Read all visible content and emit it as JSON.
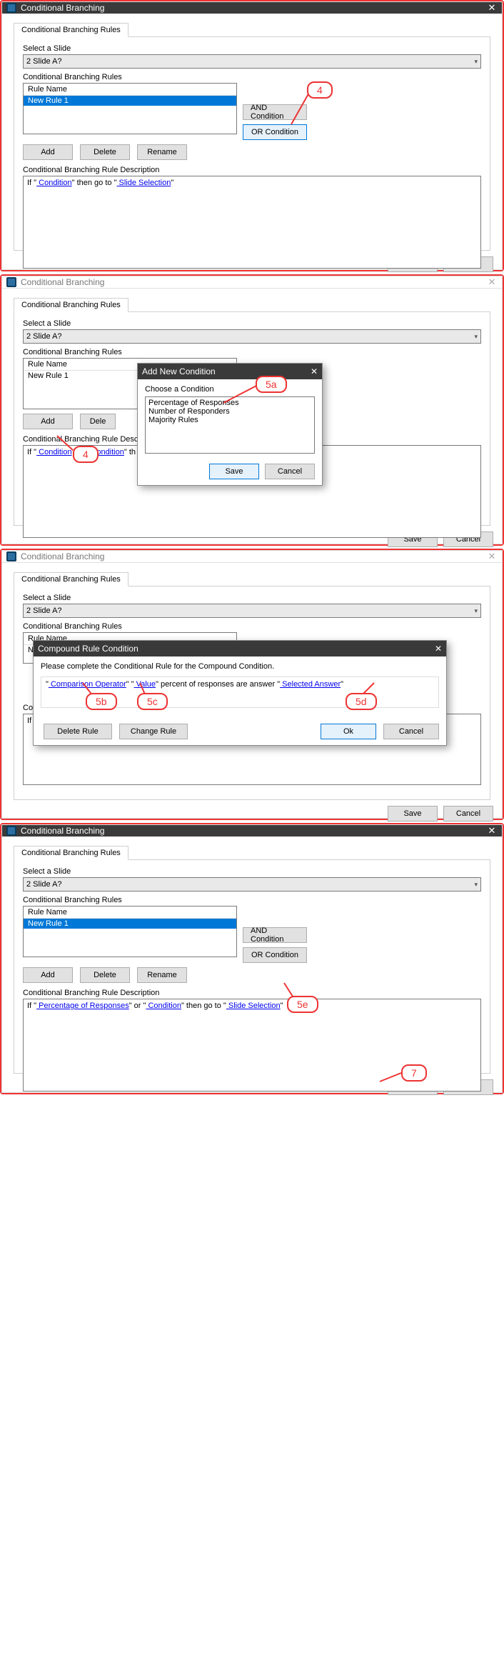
{
  "dlg": {
    "title": "Conditional Branching",
    "tab": "Conditional Branching Rules",
    "select_label": "Select a Slide",
    "select_value": "2 Slide A?",
    "rules_label": "Conditional Branching Rules",
    "rule_name_header": "Rule Name",
    "rule1": "New Rule 1",
    "and_condition": "AND Condition",
    "or_condition": "OR Condition",
    "add": "Add",
    "delete": "Delete",
    "delete_trunc": "Dele",
    "rename": "Rename",
    "desc_label": "Conditional Branching Rule Description",
    "desc_label_trunc": "Conditional Branching Rule Descrip",
    "save": "Save",
    "cancel": "Cancel",
    "ok": "Ok"
  },
  "desc1": {
    "t_if": "If \"",
    "condition": " Condition",
    "t_then": "\" then go to \"",
    "slide_sel": " Slide Selection",
    "t_end": "\""
  },
  "desc2": {
    "t_if": "If \"",
    "condition": " Condition",
    "t_or": "\" or \"",
    "t_th": "\" th"
  },
  "desc4": {
    "t_if": "If \"",
    "perc": " Percentage of Responses",
    "t_or": "\" or \"",
    "condition": " Condition",
    "t_then": "\" then go to \"",
    "slide_sel": " Slide Selection",
    "t_end": "\""
  },
  "addcond": {
    "title": "Add New Condition",
    "choose": "Choose a Condition",
    "opt1": "Percentage of Responses",
    "opt2": "Number of Responders",
    "opt3": "Majority Rules"
  },
  "compound": {
    "title": "Compound Rule Condition",
    "instr": "Please complete the Conditional Rule for the Compound Condition.",
    "q1": "\"",
    "comp_op": " Comparison Operator",
    "q2": "\" \"",
    "value": " Value",
    "q3": "\"",
    "mid": "  percent of responses are answer \"",
    "sel_ans": " Selected Answer",
    "q4": "\"",
    "delete_rule": "Delete Rule",
    "change_rule": "Change Rule"
  },
  "callouts": {
    "c4": "4",
    "c5a": "5a",
    "c5b": "5b",
    "c5c": "5c",
    "c5d": "5d",
    "c5e": "5e",
    "c7": "7"
  }
}
